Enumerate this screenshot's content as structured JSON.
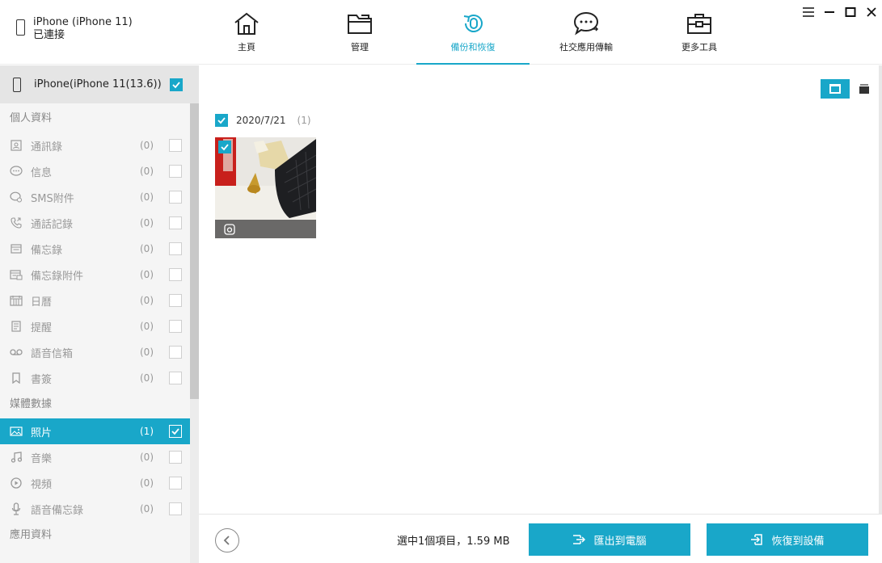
{
  "device": {
    "name": "iPhone (iPhone 11)",
    "status": "已連接"
  },
  "nav": [
    {
      "label": "主頁",
      "icon": "home-icon"
    },
    {
      "label": "管理",
      "icon": "folder-icon"
    },
    {
      "label": "備份和恢復",
      "icon": "backup-restore-icon",
      "active": true
    },
    {
      "label": "社交應用傳輸",
      "icon": "chat-transfer-icon"
    },
    {
      "label": "更多工具",
      "icon": "toolbox-icon"
    }
  ],
  "window_controls": [
    "menu-icon",
    "minimize-icon",
    "maximize-icon",
    "close-icon"
  ],
  "sidebar": {
    "device_label": "iPhone(iPhone 11(13.6))",
    "sections": [
      {
        "title": "個人資料",
        "items": [
          {
            "label": "通訊錄",
            "count": "(0)",
            "icon": "contacts-icon"
          },
          {
            "label": "信息",
            "count": "(0)",
            "icon": "message-icon"
          },
          {
            "label": "SMS附件",
            "count": "(0)",
            "icon": "sms-attachment-icon"
          },
          {
            "label": "通話記錄",
            "count": "(0)",
            "icon": "call-log-icon"
          },
          {
            "label": "備忘錄",
            "count": "(0)",
            "icon": "notes-icon"
          },
          {
            "label": "備忘錄附件",
            "count": "(0)",
            "icon": "notes-attachment-icon"
          },
          {
            "label": "日曆",
            "count": "(0)",
            "icon": "calendar-icon"
          },
          {
            "label": "提醒",
            "count": "(0)",
            "icon": "reminder-icon"
          },
          {
            "label": "語音信箱",
            "count": "(0)",
            "icon": "voicemail-icon"
          },
          {
            "label": "書簽",
            "count": "(0)",
            "icon": "bookmark-icon"
          }
        ]
      },
      {
        "title": "媒體數據",
        "items": [
          {
            "label": "照片",
            "count": "(1)",
            "icon": "photo-icon",
            "active": true
          },
          {
            "label": "音樂",
            "count": "(0)",
            "icon": "music-icon"
          },
          {
            "label": "視頻",
            "count": "(0)",
            "icon": "video-icon"
          },
          {
            "label": "語音備忘錄",
            "count": "(0)",
            "icon": "voice-memo-icon"
          }
        ]
      },
      {
        "title": "應用資料",
        "items": []
      }
    ]
  },
  "main": {
    "group": {
      "date": "2020/7/21",
      "count": "(1)"
    },
    "photo": {
      "type_icon": "camera-icon",
      "checked": true
    }
  },
  "footer": {
    "selection": "選中1個項目，1.59 MB",
    "export_label": "匯出到電腦",
    "restore_label": "恢復到設備"
  },
  "colors": {
    "accent": "#19a7c9"
  }
}
